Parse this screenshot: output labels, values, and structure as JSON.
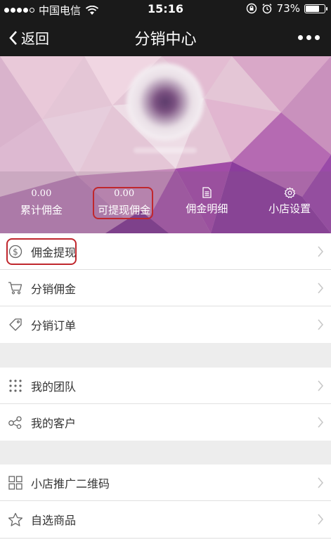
{
  "status_bar": {
    "carrier": "中国电信",
    "time": "15:16",
    "battery": "73%",
    "battery_level": 0.73
  },
  "nav": {
    "back_label": "返回",
    "title": "分销中心"
  },
  "stats": {
    "total_commission": {
      "value": "0.00",
      "label": "累计佣金"
    },
    "withdrawable_commission": {
      "value": "0.00",
      "label": "可提现佣金"
    },
    "commission_details": {
      "label": "佣金明细",
      "icon": "document-icon"
    },
    "shop_settings": {
      "label": "小店设置",
      "icon": "gear-icon"
    }
  },
  "menu_group_1": [
    {
      "label": "佣金提现",
      "icon": "dollar-circle-icon"
    },
    {
      "label": "分销佣金",
      "icon": "cart-icon"
    },
    {
      "label": "分销订单",
      "icon": "tag-icon"
    }
  ],
  "menu_group_2": [
    {
      "label": "我的团队",
      "icon": "dots-grid-icon"
    },
    {
      "label": "我的客户",
      "icon": "share-nodes-icon"
    }
  ],
  "menu_group_3": [
    {
      "label": "小店推广二维码",
      "icon": "qr-grid-icon"
    },
    {
      "label": "自选商品",
      "icon": "star-icon"
    }
  ],
  "colors": {
    "nav_bg": "#1a1a1a",
    "highlight": "#c0272d",
    "page_bg": "#ededed"
  }
}
